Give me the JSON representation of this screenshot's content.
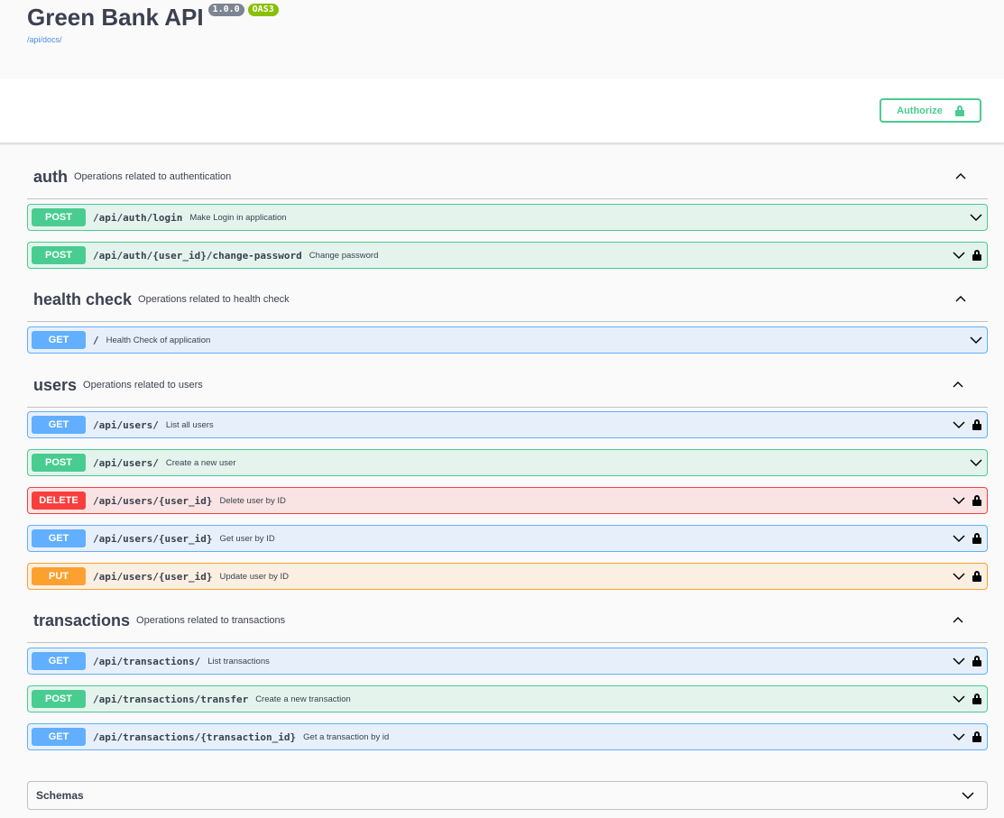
{
  "header": {
    "title": "Green Bank API",
    "version_badge": "1.0.0",
    "spec_badge": "OAS3",
    "docs_link": "/api/docs/"
  },
  "toolbar": {
    "authorize_label": "Authorize"
  },
  "tags": [
    {
      "name": "auth",
      "description": "Operations related to authentication",
      "operations": [
        {
          "method": "POST",
          "path": "/api/auth/login",
          "summary": "Make Login in application",
          "locked": false
        },
        {
          "method": "POST",
          "path": "/api/auth/{user_id}/change-password",
          "summary": "Change password",
          "locked": true
        }
      ]
    },
    {
      "name": "health check",
      "description": "Operations related to health check",
      "operations": [
        {
          "method": "GET",
          "path": "/",
          "summary": "Health Check of application",
          "locked": false
        }
      ]
    },
    {
      "name": "users",
      "description": "Operations related to users",
      "operations": [
        {
          "method": "GET",
          "path": "/api/users/",
          "summary": "List all users",
          "locked": true
        },
        {
          "method": "POST",
          "path": "/api/users/",
          "summary": "Create a new user",
          "locked": false
        },
        {
          "method": "DELETE",
          "path": "/api/users/{user_id}",
          "summary": "Delete user by ID",
          "locked": true
        },
        {
          "method": "GET",
          "path": "/api/users/{user_id}",
          "summary": "Get user by ID",
          "locked": true
        },
        {
          "method": "PUT",
          "path": "/api/users/{user_id}",
          "summary": "Update user by ID",
          "locked": true
        }
      ]
    },
    {
      "name": "transactions",
      "description": "Operations related to transactions",
      "operations": [
        {
          "method": "GET",
          "path": "/api/transactions/",
          "summary": "List transactions",
          "locked": true
        },
        {
          "method": "POST",
          "path": "/api/transactions/transfer",
          "summary": "Create a new transaction",
          "locked": true
        },
        {
          "method": "GET",
          "path": "/api/transactions/{transaction_id}",
          "summary": "Get a transaction by id",
          "locked": true
        }
      ]
    }
  ],
  "schemas": {
    "label": "Schemas"
  },
  "icons": {
    "lock": "lock-icon",
    "expand": "chevron-down-icon",
    "collapse": "chevron-up-icon"
  },
  "colors": {
    "get": "#61affe",
    "post": "#49cc90",
    "delete": "#f93e3e",
    "put": "#fca130",
    "authorize": "#49cc90"
  }
}
